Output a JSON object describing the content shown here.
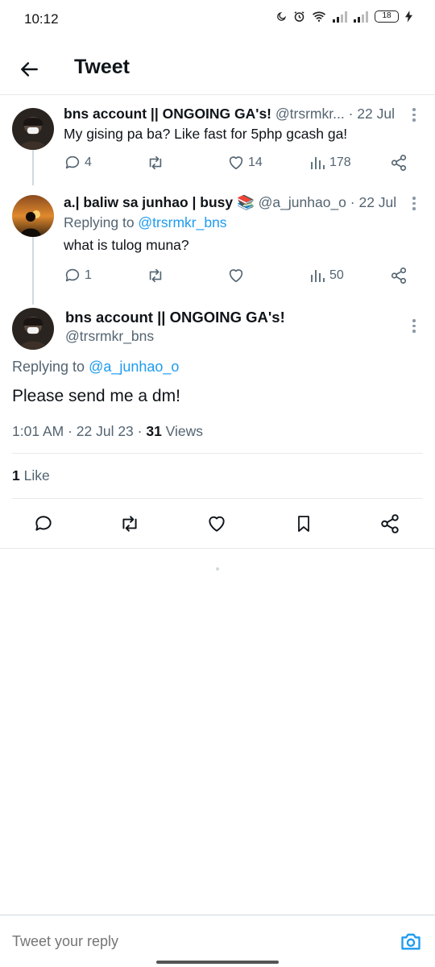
{
  "status_bar": {
    "time": "10:12",
    "battery": "18",
    "icons": [
      "moon-icon",
      "alarm-icon",
      "wifi-icon",
      "signal-icon",
      "signal-icon",
      "battery-icon",
      "charging-icon"
    ]
  },
  "header": {
    "title": "Tweet"
  },
  "thread": [
    {
      "name": "bns account || ONGOING GA's!",
      "handle": "@trsrmkr...",
      "date": " · 22 Jul",
      "text": "My gising pa ba? Like fast for 5php gcash ga!",
      "replies": "4",
      "retweets": "",
      "likes": "14",
      "views": "178"
    },
    {
      "name": "a.| baliw sa junhao | busy 📚",
      "handle": "@a_junhao_o",
      "date": " · 22 Jul",
      "replying_prefix": "Replying to ",
      "replying_to": "@trsrmkr_bns",
      "text": "what is tulog muna?",
      "replies": "1",
      "retweets": "",
      "likes": "",
      "views": "50"
    }
  ],
  "main_tweet": {
    "name": "bns account || ONGOING GA's!",
    "handle": "@trsrmkr_bns",
    "replying_prefix": "Replying to ",
    "replying_to": "@a_junhao_o",
    "text": "Please send me a dm!",
    "timestamp": "1:01 AM · 22 Jul 23 · ",
    "views_count": "31",
    "views_label": " Views",
    "likes_count": "1",
    "likes_label": " Like"
  },
  "reply_bar": {
    "placeholder": "Tweet your reply"
  },
  "colors": {
    "accent": "#1d9bf0",
    "secondary_text": "#536471",
    "primary_text": "#0f1419",
    "divider": "#e6e9ea"
  }
}
